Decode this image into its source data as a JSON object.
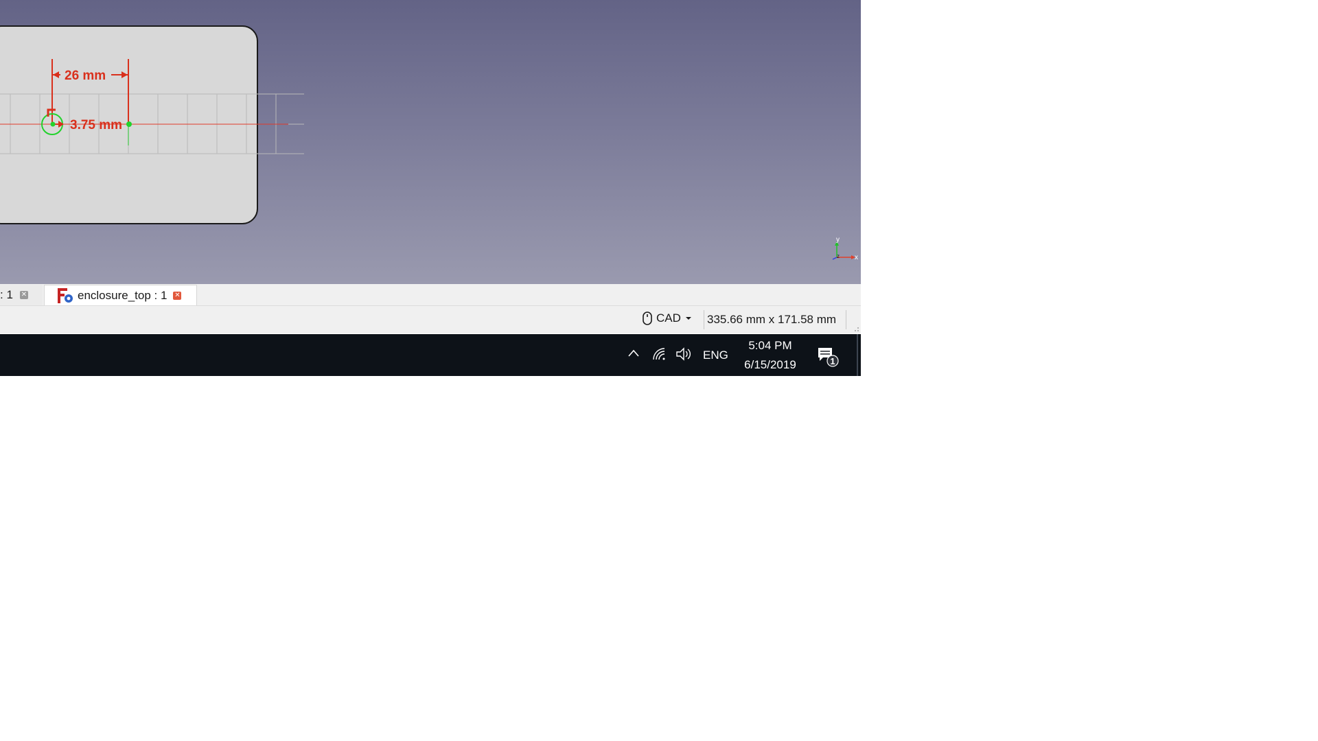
{
  "viewport": {
    "dimension_horizontal": "26 mm",
    "dimension_radius": "3.75 mm",
    "axis_x": "x",
    "axis_y": "y",
    "axis_z": "z"
  },
  "tabs": [
    {
      "label": ": 1",
      "active": false
    },
    {
      "label": "enclosure_top : 1",
      "active": true
    }
  ],
  "statusbar": {
    "navigation_style": "CAD",
    "dimensions": "335.66 mm x 171.58 mm"
  },
  "taskbar": {
    "language": "ENG",
    "time": "5:04 PM",
    "date": "6/15/2019",
    "notification_count": "1"
  },
  "colors": {
    "dimension": "#d9301c",
    "constraint": "#22d22c",
    "close_active": "#e2583c"
  },
  "icons": [
    "freecad-document-icon",
    "mouse-icon",
    "chevron-up-icon",
    "wifi-icon",
    "volume-icon",
    "action-center-icon"
  ]
}
